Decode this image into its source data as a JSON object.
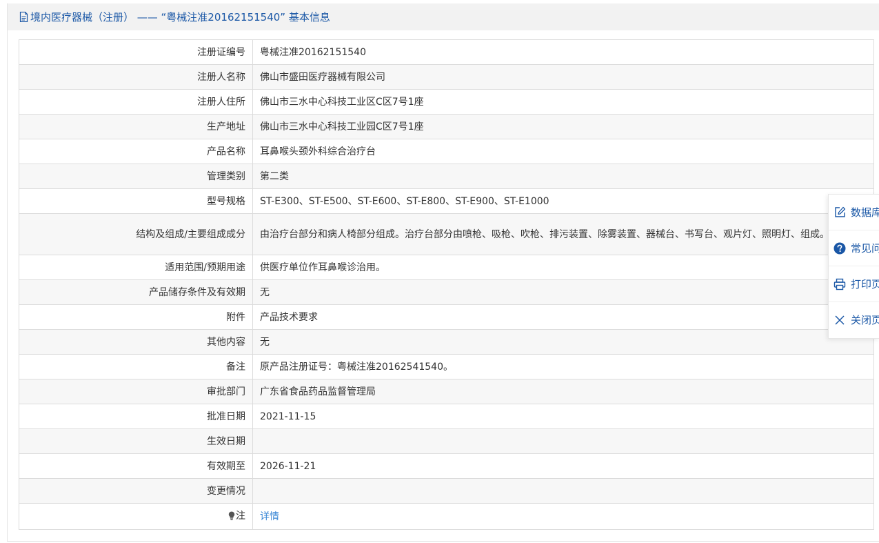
{
  "header": {
    "title": "境内医疗器械（注册） —— “粤械注准20162151540” 基本信息",
    "icon": "document-icon"
  },
  "rows": [
    {
      "label": "注册证编号",
      "value": "粤械注准20162151540"
    },
    {
      "label": "注册人名称",
      "value": "佛山市盛田医疗器械有限公司"
    },
    {
      "label": "注册人住所",
      "value": "佛山市三水中心科技工业区C区7号1座"
    },
    {
      "label": "生产地址",
      "value": "佛山市三水中心科技工业园C区7号1座"
    },
    {
      "label": "产品名称",
      "value": "耳鼻喉头颈外科综合治疗台"
    },
    {
      "label": "管理类别",
      "value": "第二类"
    },
    {
      "label": "型号规格",
      "value": "ST-E300、ST-E500、ST-E600、ST-E800、ST-E900、ST-E1000"
    },
    {
      "label": "结构及组成/主要组成成分",
      "value": "由治疗台部分和病人椅部分组成。治疗台部分由喷枪、吸枪、吹枪、排污装置、除雾装置、器械台、书写台、观片灯、照明灯、组成。"
    },
    {
      "label": "适用范围/预期用途",
      "value": "供医疗单位作耳鼻喉诊治用。"
    },
    {
      "label": "产品储存条件及有效期",
      "value": "无"
    },
    {
      "label": "附件",
      "value": "产品技术要求"
    },
    {
      "label": "其他内容",
      "value": "无"
    },
    {
      "label": "备注",
      "value": "原产品注册证号：粤械注准20162541540。"
    },
    {
      "label": "审批部门",
      "value": "广东省食品药品监督管理局"
    },
    {
      "label": "批准日期",
      "value": "2021-11-15"
    },
    {
      "label": "生效日期",
      "value": ""
    },
    {
      "label": "有效期至",
      "value": "2026-11-21"
    },
    {
      "label": "变更情况",
      "value": ""
    }
  ],
  "note": {
    "label": "注",
    "icon": "lightbulb-icon",
    "link": "详情"
  },
  "float_menu": [
    {
      "label": "数据库",
      "icon": "edit-icon"
    },
    {
      "label": "常见问",
      "icon": "help-icon"
    },
    {
      "label": "打印页",
      "icon": "print-icon"
    },
    {
      "label": "关闭页",
      "icon": "close-icon"
    }
  ],
  "colors": {
    "accent": "#1a57a6",
    "link": "#3a87d6",
    "header_bg": "#f2f2f2",
    "stripe": "#f7f7f7",
    "border": "#dcdcdc"
  }
}
